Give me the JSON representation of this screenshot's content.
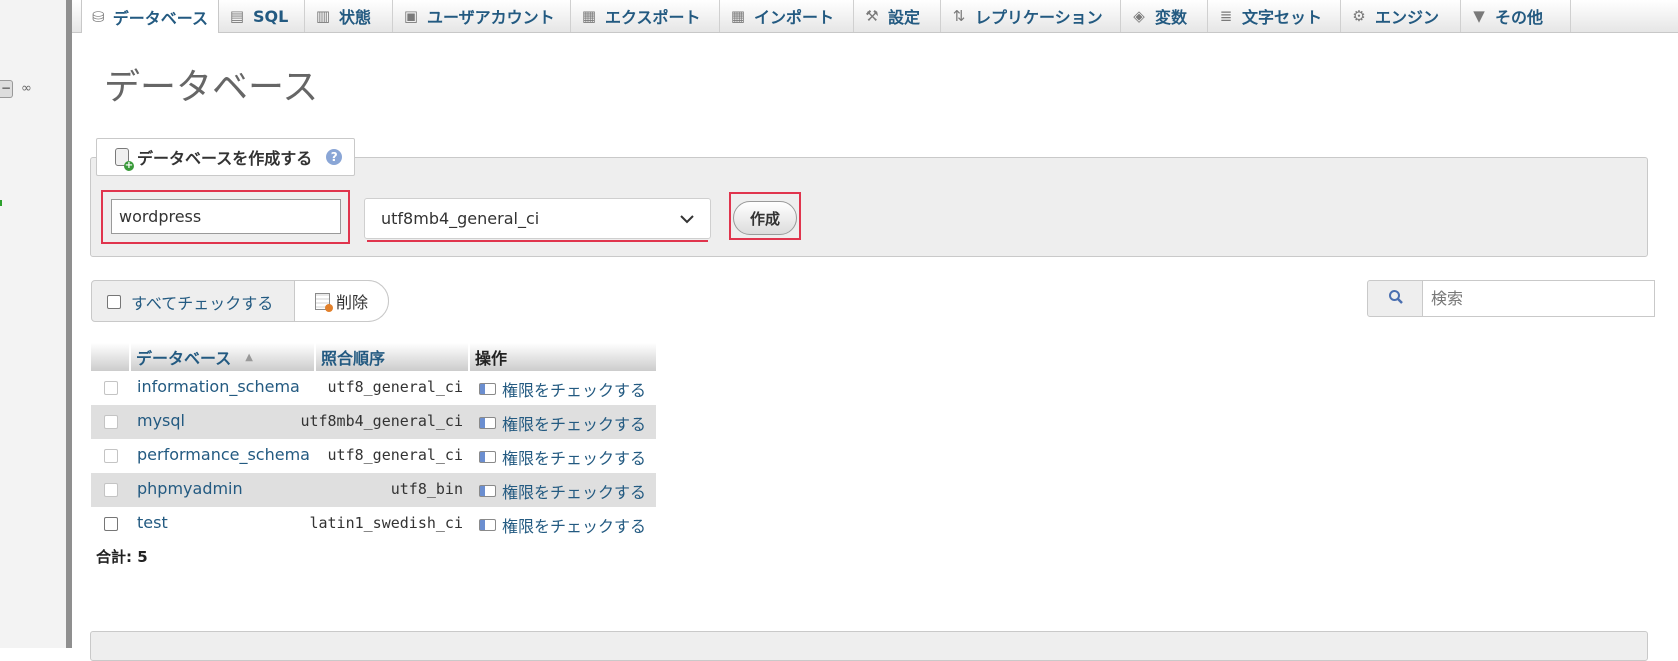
{
  "tabs": [
    {
      "label": "データベース",
      "icon": "database-icon",
      "active": true
    },
    {
      "label": "SQL",
      "icon": "sql-icon"
    },
    {
      "label": "状態",
      "icon": "status-chart-icon"
    },
    {
      "label": "ユーザアカウント",
      "icon": "users-icon"
    },
    {
      "label": "エクスポート",
      "icon": "export-icon"
    },
    {
      "label": "インポート",
      "icon": "import-icon"
    },
    {
      "label": "設定",
      "icon": "wrench-icon"
    },
    {
      "label": "レプリケーション",
      "icon": "replication-icon"
    },
    {
      "label": "変数",
      "icon": "variables-icon"
    },
    {
      "label": "文字セット",
      "icon": "charset-icon"
    },
    {
      "label": "エンジン",
      "icon": "engine-icon"
    },
    {
      "label": "その他",
      "icon": "caret-down-icon"
    }
  ],
  "page_title": "データベース",
  "create_db": {
    "legend": "データベースを作成する",
    "name_value": "wordpress",
    "collation_selected": "utf8mb4_general_ci",
    "create_label": "作成"
  },
  "list_actions": {
    "check_all_label": "すべてチェックする",
    "delete_label": "削除",
    "search_placeholder": "検索"
  },
  "table": {
    "headers": {
      "database": "データベース",
      "collation": "照合順序",
      "action": "操作"
    },
    "rows": [
      {
        "name": "information_schema",
        "collation": "utf8_general_ci",
        "action": "権限をチェックする"
      },
      {
        "name": "mysql",
        "collation": "utf8mb4_general_ci",
        "action": "権限をチェックする"
      },
      {
        "name": "performance_schema",
        "collation": "utf8_general_ci",
        "action": "権限をチェックする"
      },
      {
        "name": "phpmyadmin",
        "collation": "utf8_bin",
        "action": "権限をチェックする"
      },
      {
        "name": "test",
        "collation": "latin1_swedish_ci",
        "action": "権限をチェックする"
      }
    ],
    "total": "合計: 5"
  },
  "colors": {
    "link": "#235a81",
    "highlight": "#e0344d",
    "panel": "#eeeeee"
  }
}
